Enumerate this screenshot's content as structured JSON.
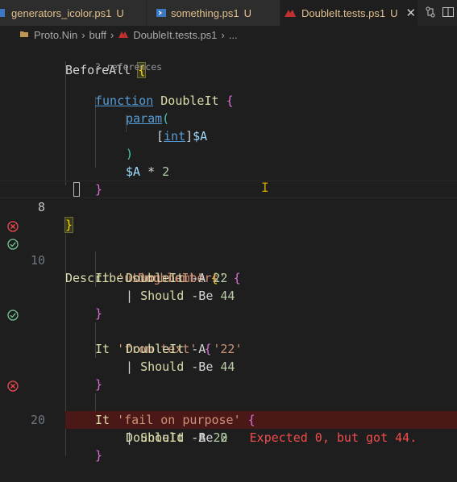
{
  "tabs": [
    {
      "label": "generators_icolor.ps1",
      "status": "U",
      "icon": "powershell-icon"
    },
    {
      "label": "something.ps1",
      "status": "U",
      "icon": "powershell-icon"
    },
    {
      "label": "DoubleIt.tests.ps1",
      "status": "U",
      "icon": "pester-test-icon",
      "close": "✕"
    }
  ],
  "actions": [
    "compare-changes-icon",
    "split-editor-icon"
  ],
  "breadcrumb": {
    "items": [
      "Proto.Nin",
      "buff",
      "DoubleIt.tests.ps1",
      "..."
    ],
    "separator": "›"
  },
  "editor": {
    "codelens": "3 references",
    "line_numbers": {
      "n8": "8",
      "n10": "10",
      "n20": "20"
    },
    "lines": {
      "l1": {
        "a": "BeforeAll ",
        "b": "{"
      },
      "l2": {
        "a": "function",
        "b": " ",
        "c": "DoubleIt",
        "d": " ",
        "e": "{"
      },
      "l3": {
        "a": "param",
        "b": "("
      },
      "l4": {
        "a": "[",
        "b": "int",
        "c": "]",
        "d": "$A"
      },
      "l5": {
        "a": ")"
      },
      "l6": {
        "a": "$A",
        "b": " * ",
        "c": "2"
      },
      "l7": {
        "a": "}"
      },
      "l8": {
        "a": "}"
      },
      "l10": {
        "a": "Describe",
        "b": " ",
        "c": "'DoubleIt'",
        "d": " ",
        "e": "{"
      },
      "l11": {
        "a": "It",
        "b": " ",
        "c": "'using numbers'",
        "d": " ",
        "e": "{"
      },
      "l12": {
        "a": "DoubleIt",
        "b": " -A ",
        "c": "22"
      },
      "l13": {
        "a": "| ",
        "b": "Should",
        "c": " -Be ",
        "d": "44"
      },
      "l14": {
        "a": "}"
      },
      "l15": {
        "a": "It",
        "b": " ",
        "c": "'from text'",
        "d": " ",
        "e": "{"
      },
      "l16": {
        "a": "DoubleIt",
        "b": " -A ",
        "c": "'22'"
      },
      "l17": {
        "a": "| ",
        "b": "Should",
        "c": " -Be ",
        "d": "44"
      },
      "l18": {
        "a": "}"
      },
      "l19": {
        "a": "It",
        "b": " ",
        "c": "'fail on purpose'",
        "d": " ",
        "e": "{"
      },
      "l20": {
        "a": "DoubleIt",
        "b": " -A ",
        "c": "22"
      },
      "l21": {
        "a": "| ",
        "b": "Should",
        "c": " -Be ",
        "d": "0",
        "e": "   Expected 0, but got 44."
      },
      "l22": {
        "a": "}"
      }
    },
    "test_status": {
      "describe": "failed",
      "using_numbers": "passed",
      "from_text": "passed",
      "fail_on_purpose": "failed"
    }
  },
  "colors": {
    "background": "#1e1e1e",
    "error_line": "#4b1818",
    "error_text": "#f14c4c",
    "passed": "#73c991",
    "failed": "#f14c4c",
    "untracked": "#e2c08d"
  }
}
